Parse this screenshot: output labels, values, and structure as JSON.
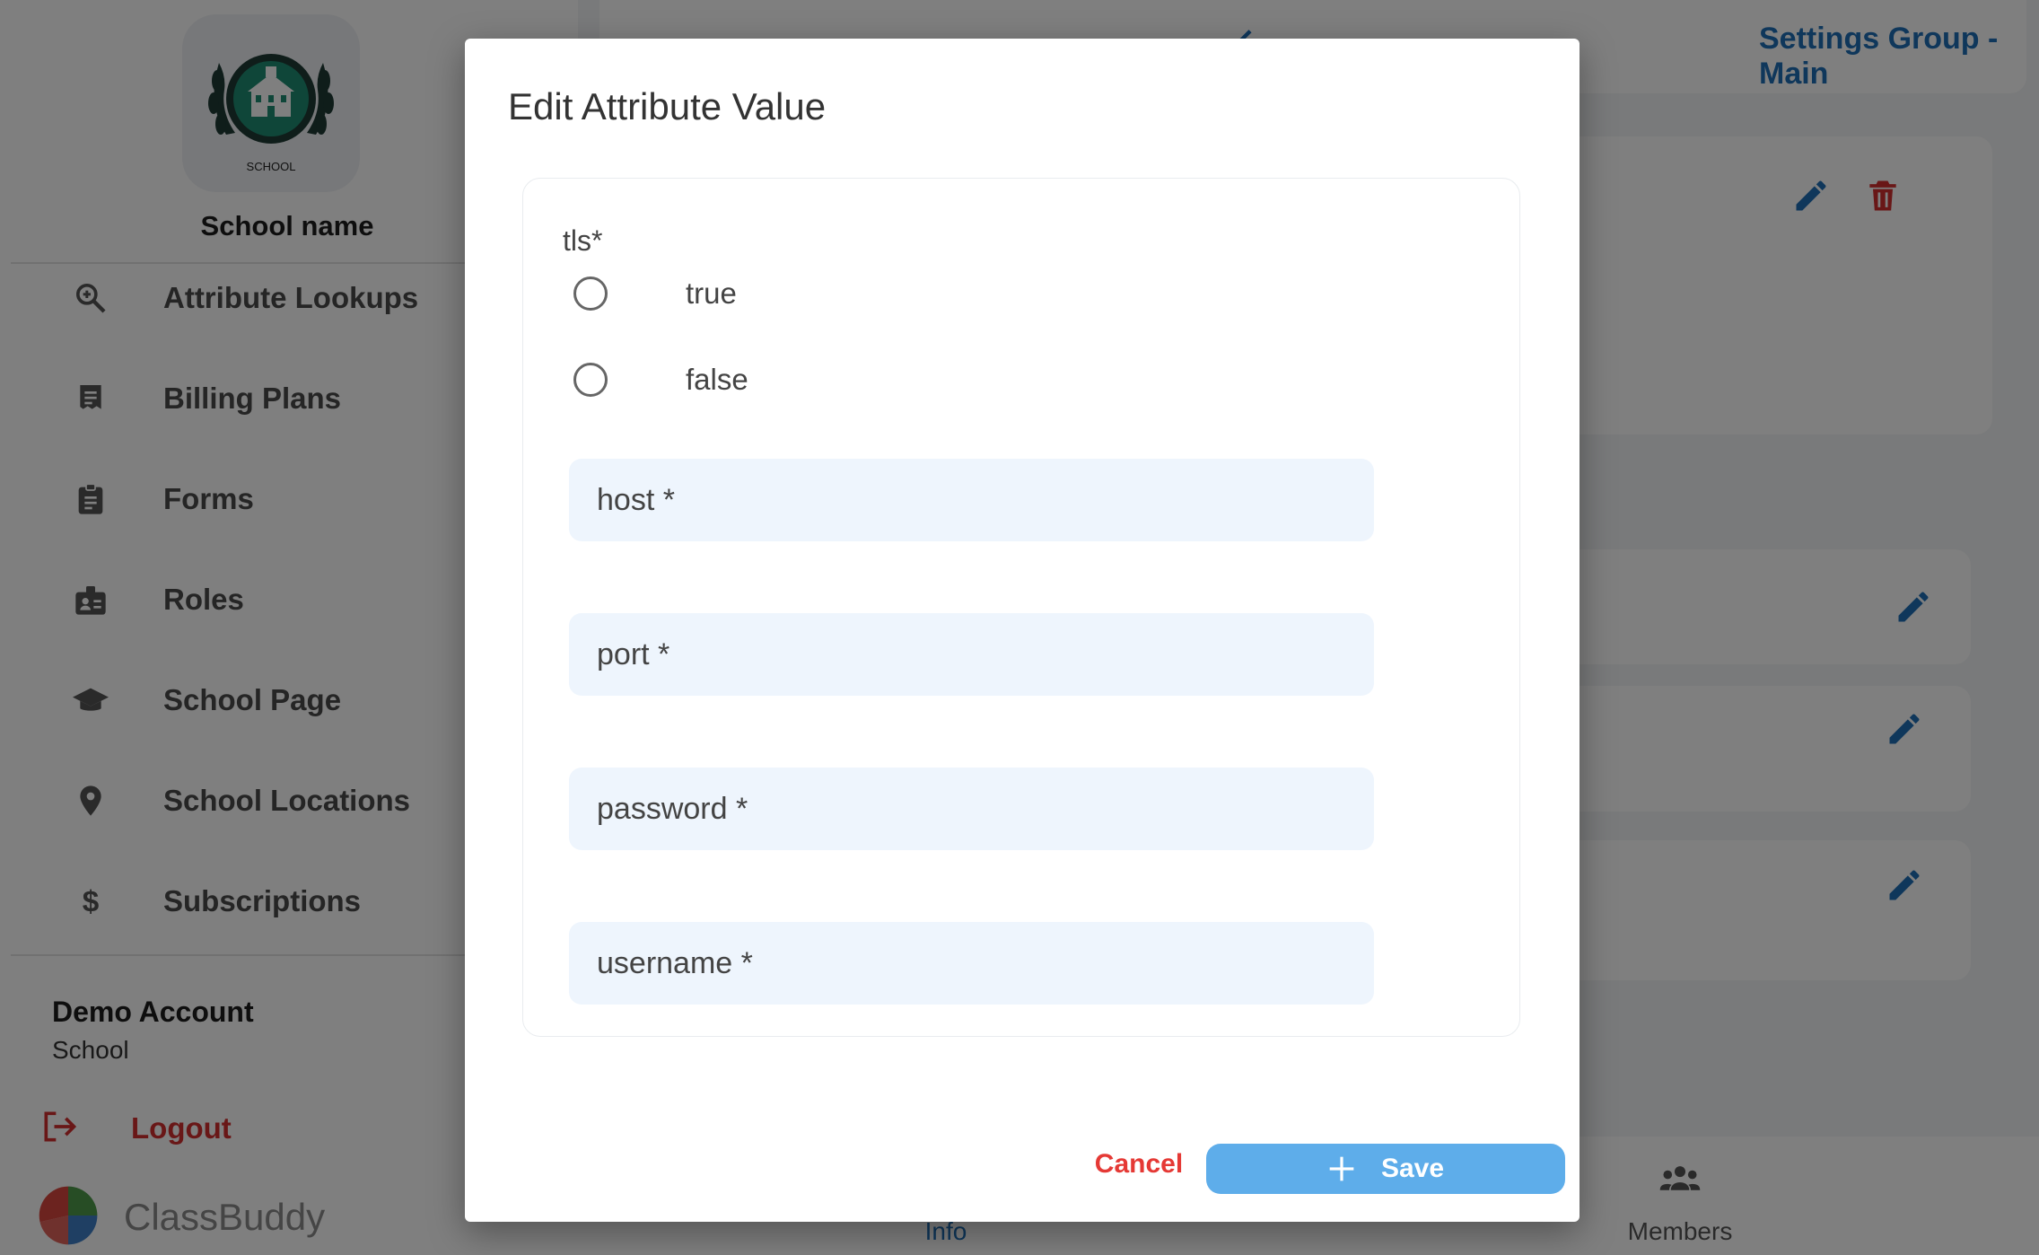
{
  "sidebar": {
    "logo_text": "SCHOOL",
    "school_name": "School name",
    "items": [
      {
        "label": "Attribute Lookups",
        "icon": "search-icon"
      },
      {
        "label": "Billing Plans",
        "icon": "receipt-icon"
      },
      {
        "label": "Forms",
        "icon": "clipboard-icon"
      },
      {
        "label": "Roles",
        "icon": "badge-icon"
      },
      {
        "label": "School Page",
        "icon": "graduation-cap-icon"
      },
      {
        "label": "School Locations",
        "icon": "location-pin-icon"
      },
      {
        "label": "Subscriptions",
        "icon": "dollar-icon"
      }
    ],
    "account": {
      "name": "Demo Account",
      "role": "School"
    },
    "logout_label": "Logout",
    "brand": "ClassBuddy"
  },
  "main": {
    "header_title": "Settings Group - Main",
    "tabs": [
      {
        "label": "Info",
        "icon": "info-icon"
      },
      {
        "label": "Members",
        "icon": "group-icon"
      }
    ]
  },
  "dialog": {
    "title": "Edit Attribute Value",
    "tls_label": "tls*",
    "tls_options": [
      "true",
      "false"
    ],
    "fields": [
      {
        "placeholder": "host *",
        "value": ""
      },
      {
        "placeholder": "port *",
        "value": ""
      },
      {
        "placeholder": "password *",
        "value": ""
      },
      {
        "placeholder": "username *",
        "value": ""
      }
    ],
    "cancel_label": "Cancel",
    "save_label": "Save"
  },
  "colors": {
    "accent": "#5eadea",
    "danger": "#e53935",
    "edit_icon": "#1e6fb6",
    "field_bg": "#eef5fd"
  }
}
